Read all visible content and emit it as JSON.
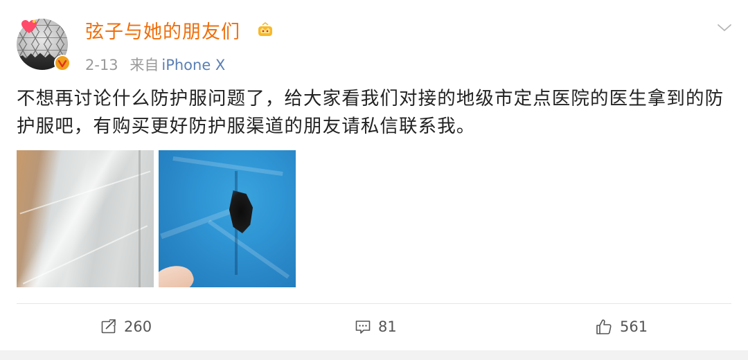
{
  "post": {
    "author": {
      "name": "弦子与她的朋友们"
    },
    "meta": {
      "date": "2-13",
      "source_prefix": "来自",
      "source": "iPhone X"
    },
    "text": "不想再讨论什么防护服问题了，给大家看我们对接的地级市定点医院的医生拿到的防护服吧，有购买更好防护服渠道的朋友请私信联系我。",
    "images": [
      {
        "description_icon": "photo-protective-suit-package"
      },
      {
        "description_icon": "photo-torn-blue-suit"
      }
    ],
    "actions": {
      "repost_count": "260",
      "comment_count": "81",
      "like_count": "561"
    }
  },
  "colors": {
    "username": "#f06e0a",
    "source_link": "#5a7fb5",
    "text": "#222222",
    "muted": "#9a9a9a"
  },
  "icons": {
    "expand": "chevron-down-icon",
    "repost": "repost-icon",
    "comment": "comment-icon",
    "like": "thumbs-up-icon",
    "verified": "verified-badge-icon",
    "member": "crown-icon"
  }
}
